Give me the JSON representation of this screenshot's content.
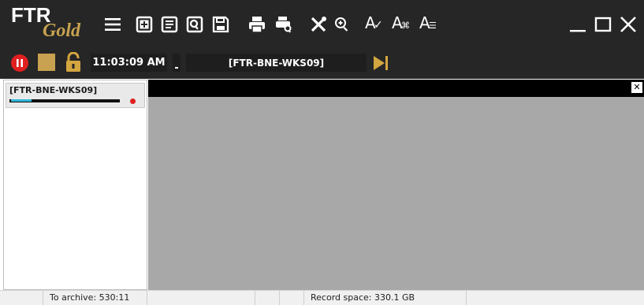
{
  "app": {
    "logo_main": "FTR",
    "logo_sub": "Gold"
  },
  "toolbar": {
    "items": [
      {
        "icon": "menu-icon"
      },
      {
        "icon": "add-record-icon"
      },
      {
        "icon": "notes-icon"
      },
      {
        "icon": "search-document-icon"
      },
      {
        "icon": "save-icon"
      },
      {
        "icon": "print-icon"
      },
      {
        "icon": "print-preview-icon"
      },
      {
        "icon": "tools-icon"
      },
      {
        "icon": "zoom-icon"
      },
      {
        "icon": "spellcheck-icon"
      },
      {
        "icon": "text-format-icon"
      },
      {
        "icon": "text-list-icon"
      }
    ],
    "spell_label": "A",
    "format_label": "A",
    "format_sub": "⌘",
    "list_label": "A",
    "list_sub": "☰"
  },
  "window_controls": {
    "minimize_icon": "minimize-icon",
    "maximize_icon": "maximize-icon",
    "close_icon": "close-icon"
  },
  "controls": {
    "time": "11:03:09 AM",
    "channel": "[FTR-BNE-WKS09]",
    "record_color": "#e02020",
    "stop_color": "#c8a250",
    "accent_color": "#d4a640"
  },
  "left_panel": {
    "channel_label": "[FTR-BNE-WKS09]",
    "level": 0.18
  },
  "statusbar": {
    "to_archive": "To archive: 530:11",
    "record_space": "Record space: 330.1 GB"
  }
}
